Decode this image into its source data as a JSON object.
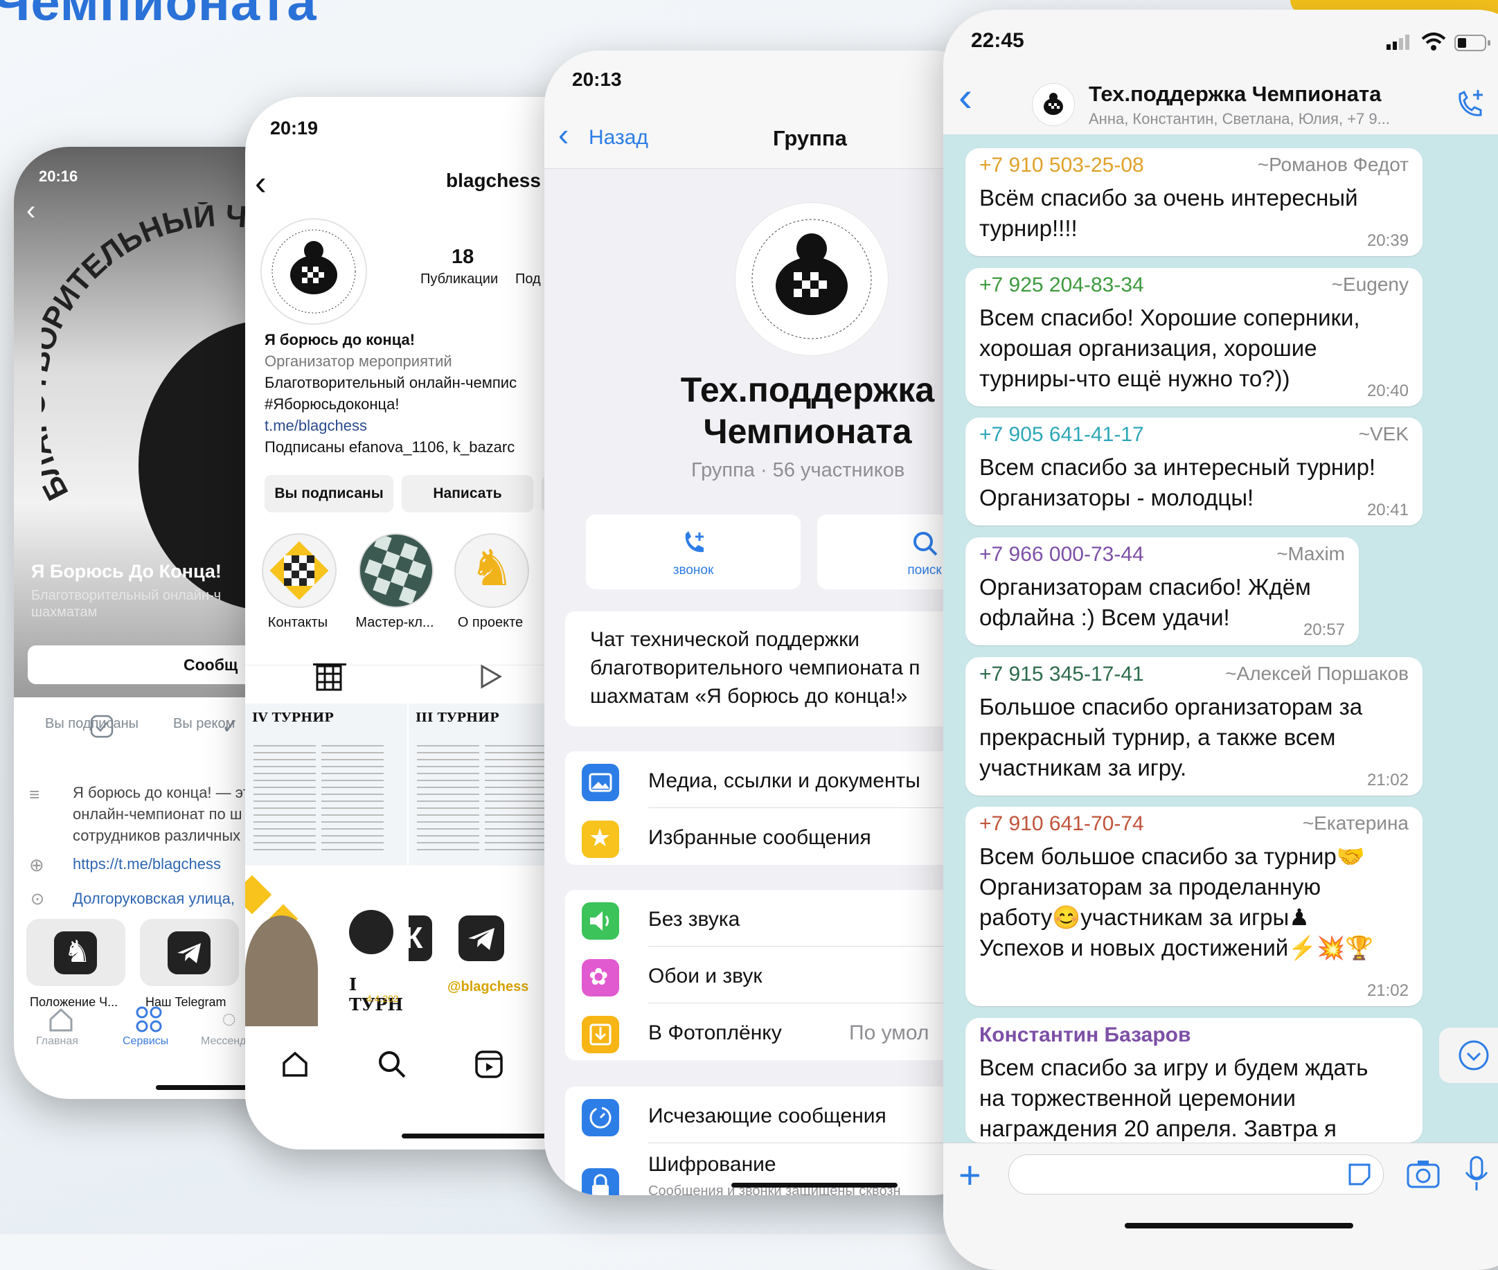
{
  "header": {
    "title": "Чемпионата"
  },
  "phone1": {
    "time": "20:16",
    "hero_title": "Я Борюсь До Конца!",
    "hero_subtitle": "Благотворительный онлайн-ч шахматам",
    "message_button": "Сообщ",
    "stats": [
      "Вы подписаны",
      "Вы реком"
    ],
    "description": "Я борюсь до конца! — эт онлайн-чемпионат по ш сотрудников различных",
    "link": "https://t.me/blagchess",
    "address": "Долгоруковская улица,",
    "tiles": [
      "Положение Ч...",
      "Наш Telegram"
    ],
    "tabs": [
      "Главная",
      "Сервисы",
      "Мессенд"
    ]
  },
  "phone2": {
    "time": "20:19",
    "handle": "blagchess",
    "posts_count": "18",
    "posts_label": "Публикации",
    "followers_label": "Под",
    "bio_name": "Я борюсь до конца!",
    "bio_category": "Организатор мероприятий",
    "bio_line1": "Благотворительный онлайн-чемпис",
    "bio_line2": "#Яборюсьдоконца!",
    "bio_link": "t.me/blagchess",
    "bio_followed": "Подписаны efanova_1106, k_bazarc",
    "buttons": [
      "Вы подписаны",
      "Написать"
    ],
    "highlights": [
      "Контакты",
      "Мастер-кл...",
      "О проекте"
    ],
    "posts": [
      "IV ТУРНИР",
      "III ТУРНИР",
      "I ТУРН",
      "4.4.202",
      "@blagchess"
    ]
  },
  "phone3": {
    "time": "20:13",
    "back": "Назад",
    "title": "Группа",
    "group_title": "Тех.поддержка Чемпионата",
    "group_subtitle": "Группа · 56 участников",
    "actions": [
      "звонок",
      "поиск"
    ],
    "description": "Чат технической поддержки благотворительного чемпионата п шахматам «Я борюсь до конца!»",
    "rows1": [
      "Медиа, ссылки и документы",
      "Избранные сообщения"
    ],
    "rows2": [
      "Без звука",
      "Обои и звук",
      "В Фотоплёнку"
    ],
    "photo_value": "По умол",
    "rows3": [
      "Исчезающие сообщения",
      "Шифрование"
    ],
    "encrypt_sub": "Сообщения и звонки защищены сквозн",
    "colors": {
      "blue": "#2d7de6",
      "yellow": "#f7c31c",
      "green": "#3cc35a",
      "pink": "#e15ad0",
      "orange": "#f7b516"
    }
  },
  "phone4": {
    "time": "22:45",
    "chat_title": "Тех.поддержка Чемпионата",
    "chat_members": "Анна, Константин, Светлана, Юлия, +7 9...",
    "messages": [
      {
        "phone": "+7 910 503-25-08",
        "name": "~Романов Федот",
        "text": "Всём спасибо за очень интересный турнир!!!!",
        "time": "20:39",
        "color": "#e0a12a"
      },
      {
        "phone": "+7 925 204-83-34",
        "name": "~Eugeny",
        "text": "Всем спасибо! Хорошие соперники, хорошая организация, хорошие турниры-что ещё нужно то?))",
        "time": "20:40",
        "color": "#3e9a3e"
      },
      {
        "phone": "+7 905 641-41-17",
        "name": "~VEK",
        "text": "Всем спасибо за интересный турнир! Организаторы - молодцы!",
        "time": "20:41",
        "color": "#2ea7b8"
      },
      {
        "phone": "+7 966 000-73-44",
        "name": "~Maxim",
        "text": "Организаторам спасибо! Ждём офлайна :) Всем удачи!",
        "time": "20:57",
        "color": "#7d4fa6"
      },
      {
        "phone": "+7 915 345-17-41",
        "name": "~Алексей Поршаков",
        "text": "Большое спасибо организаторам за прекрасный турнир, а также всем участникам за игру.",
        "time": "21:02",
        "color": "#2c6b4b"
      },
      {
        "phone": "+7 910 641-70-74",
        "name": "~Екатерина",
        "text": "Всем большое спасибо за турнир🤝 Организаторам за проделанную работу😊участникам за игры♟ Успехов и новых достижений⚡💥🏆",
        "time": "21:02",
        "color": "#c0533a"
      },
      {
        "phone": "Константин Базаров",
        "name": "",
        "text": "Всем спасибо за игру и будем ждать на торжественной церемонии награждения 20 апреля. Завтра я",
        "time": "",
        "color": "#7d4fa6"
      }
    ]
  }
}
